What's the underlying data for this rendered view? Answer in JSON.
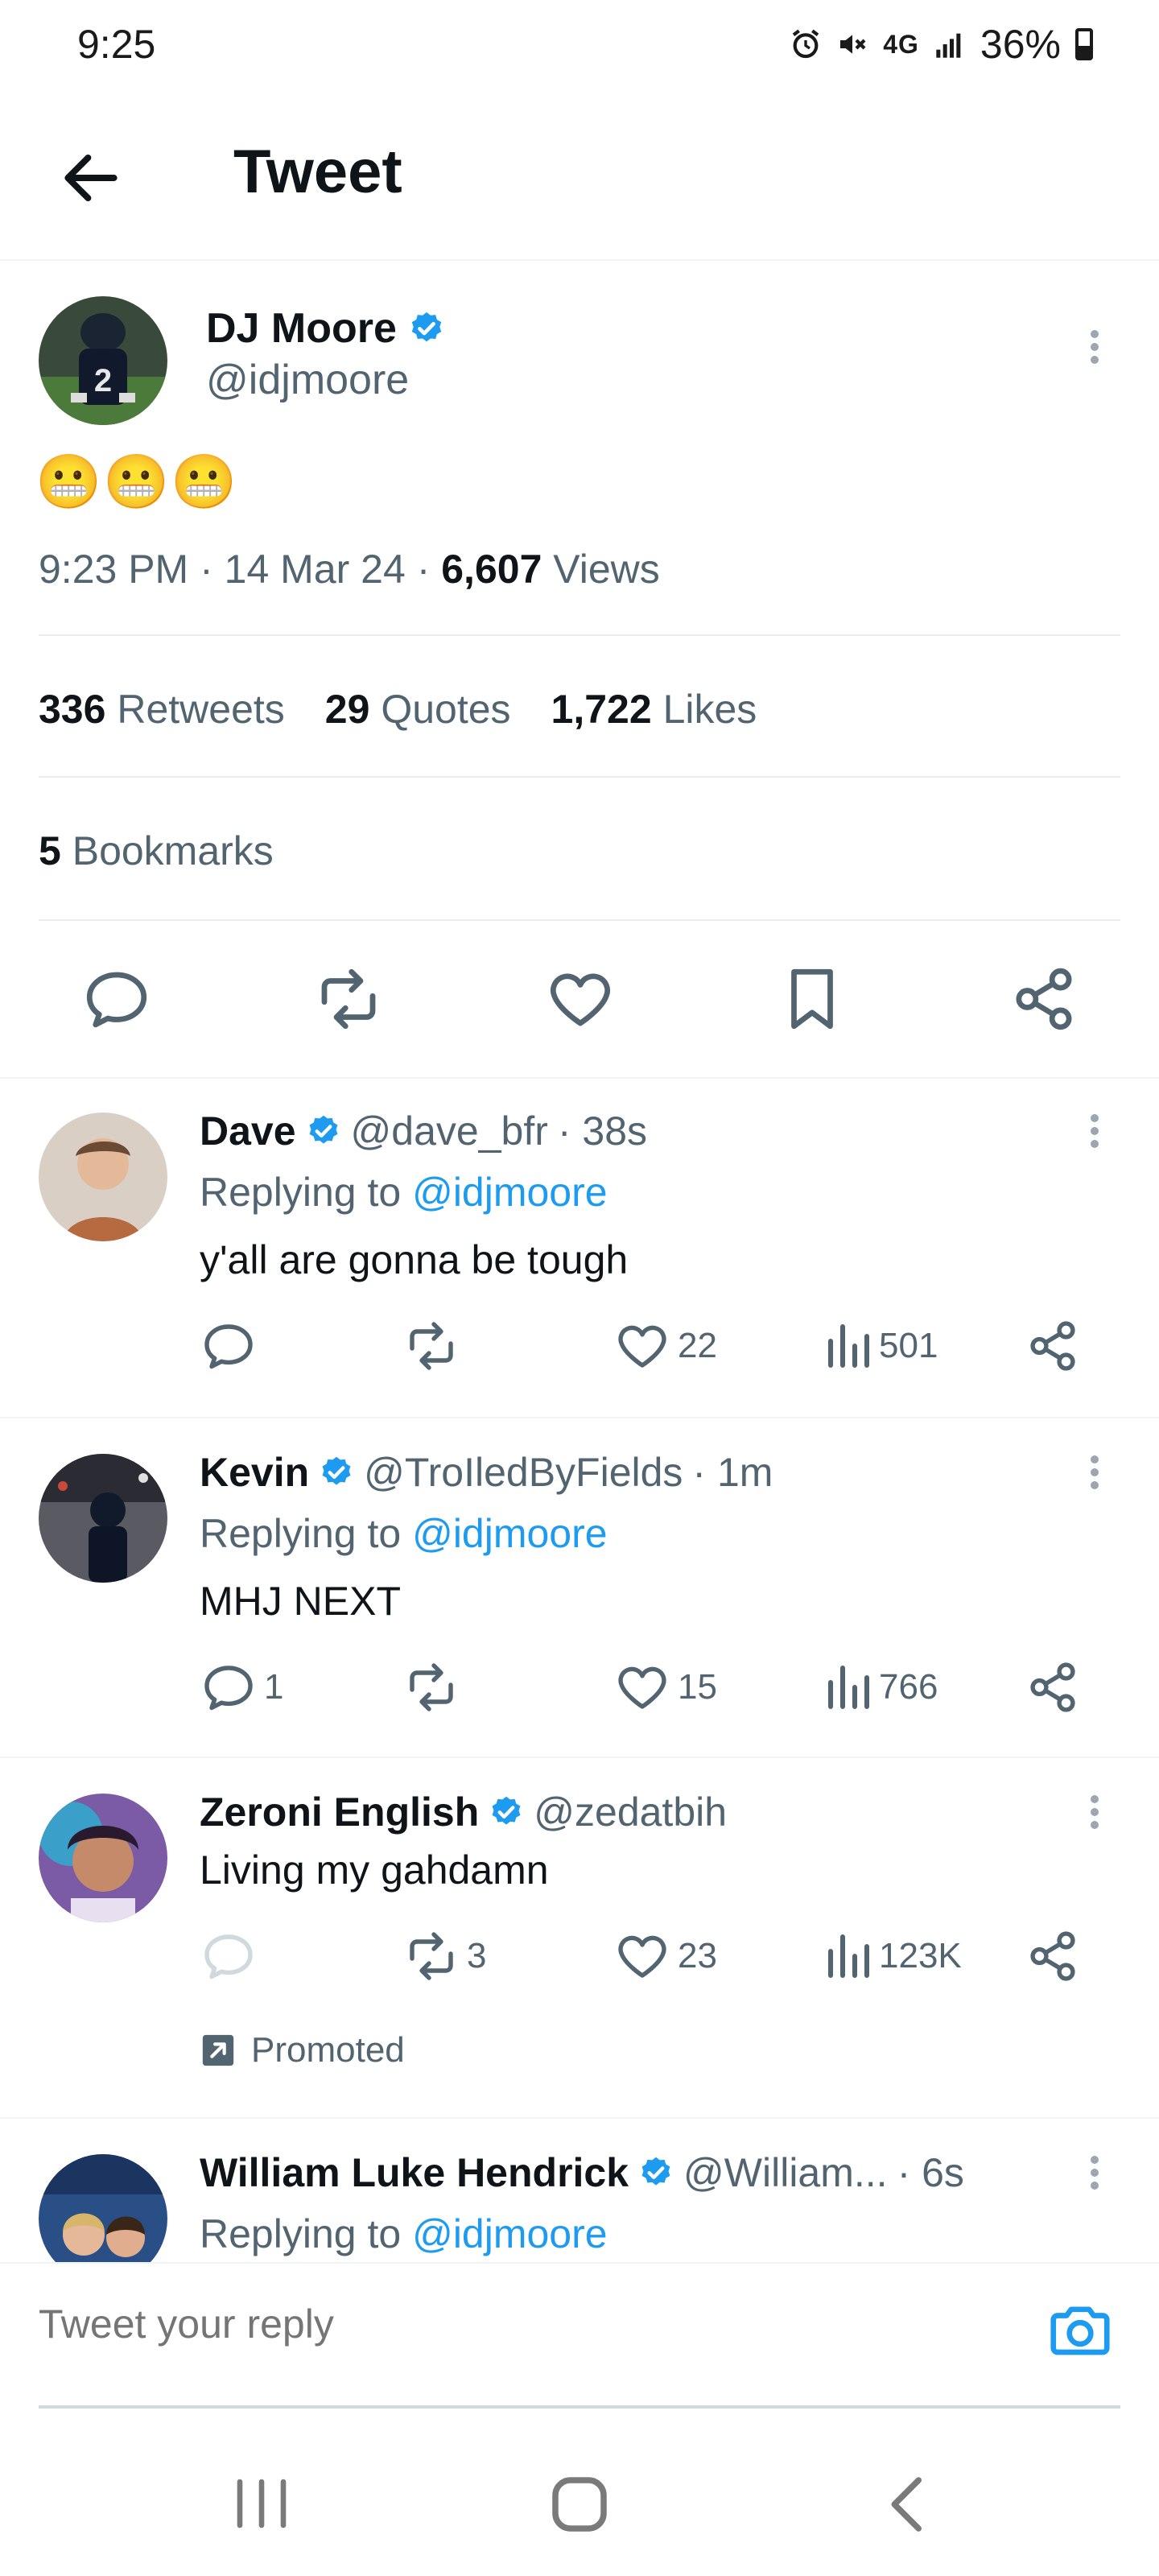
{
  "status": {
    "time": "9:25",
    "network": "4G",
    "battery": "36%"
  },
  "header": {
    "title": "Tweet"
  },
  "main_tweet": {
    "name": "DJ Moore",
    "handle": "@idjmoore",
    "emoji": "😬😬😬",
    "time": "9:23 PM",
    "date": "14 Mar 24",
    "views_count": "6,607",
    "views_label": "Views",
    "retweets_count": "336",
    "retweets_label": "Retweets",
    "quotes_count": "29",
    "quotes_label": "Quotes",
    "likes_count": "1,722",
    "likes_label": "Likes",
    "bookmarks_count": "5",
    "bookmarks_label": "Bookmarks"
  },
  "replies": [
    {
      "name": "Dave",
      "handle": "@dave_bfr",
      "time": "· 38s",
      "replying_prefix": "Replying to",
      "replying_to": "@idjmoore",
      "text": "y'all are gonna be tough",
      "reply_count": "",
      "retweet_count": "",
      "like_count": "22",
      "view_count": "501"
    },
    {
      "name": "Kevin",
      "handle": "@TroIledByFields",
      "time": "· 1m",
      "replying_prefix": "Replying to",
      "replying_to": "@idjmoore",
      "text": "MHJ NEXT",
      "reply_count": "1",
      "retweet_count": "",
      "like_count": "15",
      "view_count": "766"
    },
    {
      "name": "Zeroni English",
      "handle": "@zedatbih",
      "text": "Living my gahdamn",
      "reply_count": "",
      "retweet_count": "3",
      "like_count": "23",
      "view_count": "123K",
      "promoted": "Promoted"
    },
    {
      "name": "William Luke Hendrick",
      "handle": "@William...",
      "time": "· 6s",
      "replying_prefix": "Replying to",
      "replying_to": "@idjmoore"
    }
  ],
  "compose": {
    "placeholder": "Tweet your reply"
  },
  "colors": {
    "accent": "#1d9bf0",
    "secondary_text": "#536471",
    "primary_text": "#0f1419"
  }
}
